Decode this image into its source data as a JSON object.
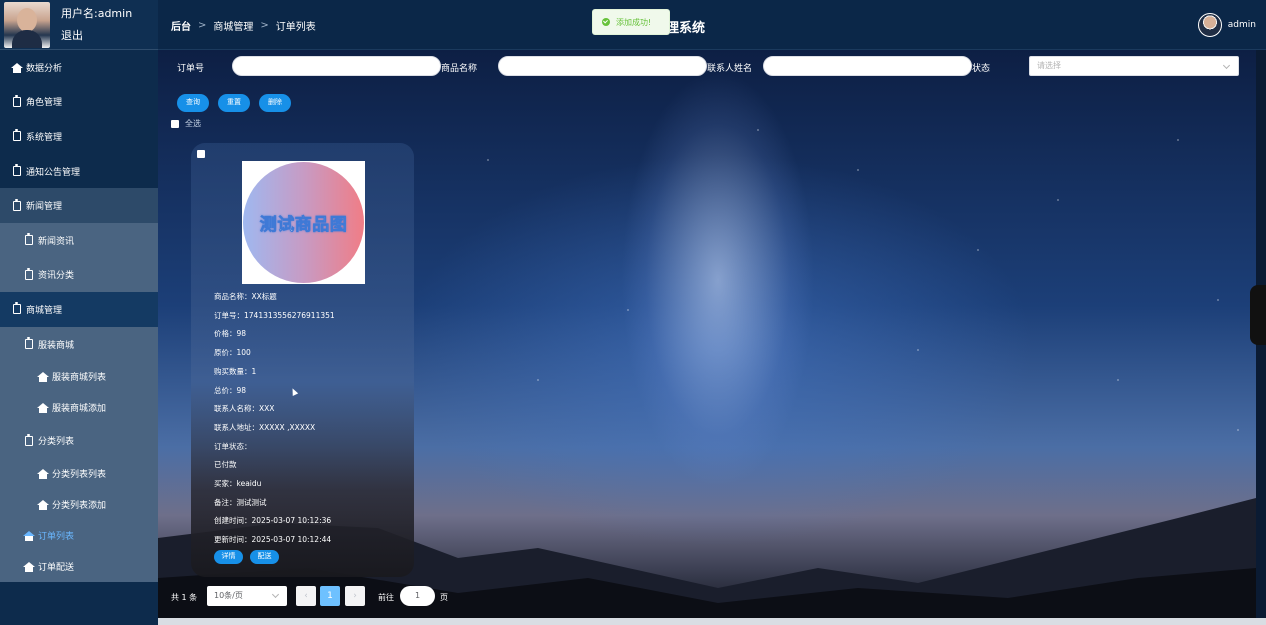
{
  "user": {
    "name_label": "用户名:admin",
    "logout": "退出"
  },
  "sidebar": {
    "items": [
      {
        "label": "数据分析",
        "icon": "home-icon"
      },
      {
        "label": "角色管理",
        "icon": "clipboard-icon"
      },
      {
        "label": "系统管理",
        "icon": "clipboard-icon"
      },
      {
        "label": "通知公告管理",
        "icon": "clipboard-icon"
      },
      {
        "label": "新闻管理",
        "icon": "clipboard-icon"
      },
      {
        "label": "新闻资讯",
        "icon": "clipboard-icon"
      },
      {
        "label": "资讯分类",
        "icon": "clipboard-icon"
      },
      {
        "label": "商城管理",
        "icon": "clipboard-icon"
      },
      {
        "label": "服装商城",
        "icon": "clipboard-icon"
      },
      {
        "label": "服装商城列表",
        "icon": "home-icon"
      },
      {
        "label": "服装商城添加",
        "icon": "home-icon"
      },
      {
        "label": "分类列表",
        "icon": "clipboard-icon"
      },
      {
        "label": "分类列表列表",
        "icon": "home-icon"
      },
      {
        "label": "分类列表添加",
        "icon": "home-icon"
      },
      {
        "label": "订单列表",
        "icon": "home-icon"
      },
      {
        "label": "订单配送",
        "icon": "home-icon"
      }
    ]
  },
  "header": {
    "breadcrumb": [
      "后台",
      "商城管理",
      "订单列表"
    ],
    "separator": ">",
    "title_visible": "理系统",
    "toast": "添加成功!",
    "user": "admin"
  },
  "search": {
    "order_no_label": "订单号",
    "product_name_label": "商品名称",
    "contact_name_label": "联系人姓名",
    "status_label": "状态",
    "status_placeholder": "请选择"
  },
  "actions": {
    "query": "查询",
    "reset": "重置",
    "delete": "删除",
    "select_all": "全选"
  },
  "order": {
    "image_text": "测试商品图",
    "product_name": "商品名称：XX标题",
    "order_no": "订单号：1741313556276911351",
    "price": "价格：98",
    "original_price": "原价：100",
    "quantity": "购买数量：1",
    "total": "总价：98",
    "contact_name": "联系人名称：XXX",
    "contact_address": "联系人地址：XXXXX ,XXXXX",
    "status_label": "订单状态：",
    "status_value": "已付款",
    "buyer": "买家：keaidu",
    "remark": "备注：测试测试",
    "created": "创建时间：2025-03-07 10:12:36",
    "updated": "更新时间：2025-03-07 10:12:44",
    "detail_btn": "详情",
    "ship_btn": "配送"
  },
  "pagination": {
    "total": "共 1 条",
    "page_size": "10条/页",
    "prev": "‹",
    "current_page": "1",
    "next": "›",
    "goto_label": "前往",
    "goto_value": "1",
    "page_unit": "页"
  },
  "colors": {
    "accent": "#1790e8",
    "sidebar_bg": "#0d2b4c",
    "success": "#67c23a"
  }
}
